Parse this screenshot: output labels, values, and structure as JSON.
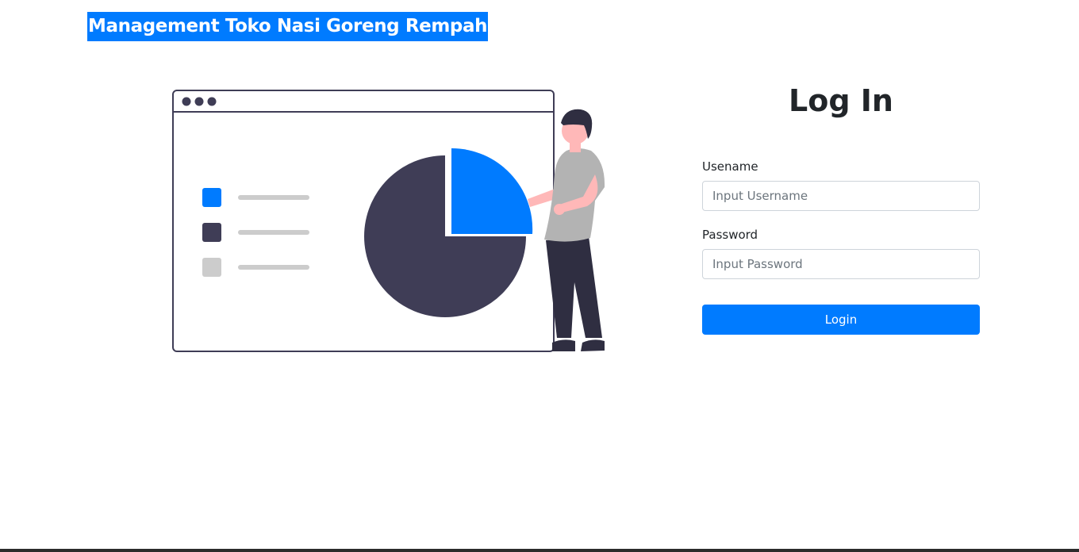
{
  "header": {
    "brand_title": "Management Toko Nasi Goreng Rempah"
  },
  "login": {
    "heading": "Log In",
    "username_label": "Usename",
    "username_placeholder": "Input Username",
    "username_value": "",
    "password_label": "Password",
    "password_placeholder": "Input Password",
    "password_value": "",
    "submit_label": "Login"
  },
  "colors": {
    "accent": "#007bff",
    "dark": "#3f3d56",
    "light_gray": "#cccccc",
    "skin": "#ffb8b8"
  }
}
